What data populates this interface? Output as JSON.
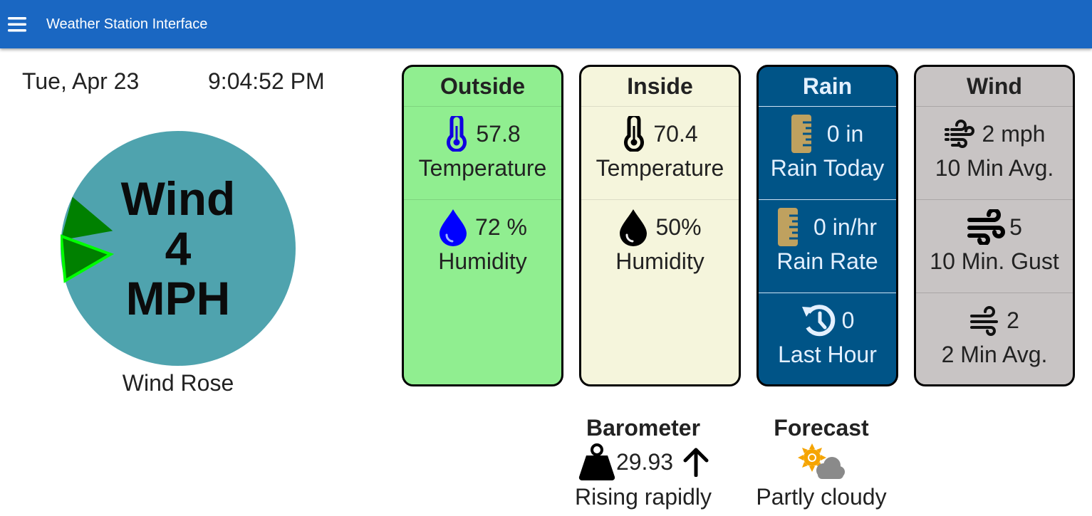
{
  "appbar": {
    "title": "Weather Station Interface",
    "menu_icon": "hamburger-menu-icon",
    "color": "#1a67c2"
  },
  "datetime": {
    "date": "Tue, Apr 23",
    "time": "9:04:52 PM"
  },
  "wind_rose": {
    "line1": "Wind",
    "line2": "4",
    "line3": "MPH",
    "label": "Wind Rose",
    "face_color": "#4fa3ae",
    "wedges": [
      {
        "name": "recent-direction-marker",
        "bearing_deg": 285,
        "color": "#008000"
      },
      {
        "name": "current-direction-marker",
        "bearing_deg": 265,
        "color": "#008000",
        "outline": "#00ff00"
      }
    ]
  },
  "cards": {
    "outside": {
      "title": "Outside",
      "temperature": {
        "value": "57.8",
        "label": "Temperature",
        "icon": "thermometer-icon",
        "icon_color": "#0000ee"
      },
      "humidity": {
        "value": "72 %",
        "label": "Humidity",
        "icon": "water-drop-icon",
        "icon_color": "#0000ff"
      },
      "bg": "#90ee90"
    },
    "inside": {
      "title": "Inside",
      "temperature": {
        "value": "70.4",
        "label": "Temperature",
        "icon": "thermometer-icon"
      },
      "humidity": {
        "value": "50%",
        "label": "Humidity",
        "icon": "water-drop-icon"
      },
      "bg": "#f5f5dc"
    },
    "rain": {
      "title": "Rain",
      "today": {
        "value": "0 in",
        "label": "Rain Today",
        "icon": "rain-gauge-icon"
      },
      "rate": {
        "value": "0 in/hr",
        "label": "Rain Rate",
        "icon": "rain-gauge-icon"
      },
      "last_hour": {
        "value": "0",
        "label": "Last Hour",
        "icon": "history-icon"
      },
      "bg": "#005487"
    },
    "wind": {
      "title": "Wind",
      "avg10": {
        "value": "2 mph",
        "label": "10 Min Avg.",
        "icon": "wind-dashed-icon"
      },
      "gust10": {
        "value": "5",
        "label": "10 Min. Gust",
        "icon": "wind-strong-icon"
      },
      "avg2": {
        "value": "2",
        "label": "2 Min Avg.",
        "icon": "wind-icon"
      },
      "bg": "#c8c4c4"
    }
  },
  "barometer": {
    "title": "Barometer",
    "value": "29.93",
    "trend_icon": "arrow-up-icon",
    "trend": "Rising rapidly",
    "icon": "weight-icon"
  },
  "forecast": {
    "title": "Forecast",
    "icon": "partly-cloudy-icon",
    "text": "Partly cloudy"
  }
}
